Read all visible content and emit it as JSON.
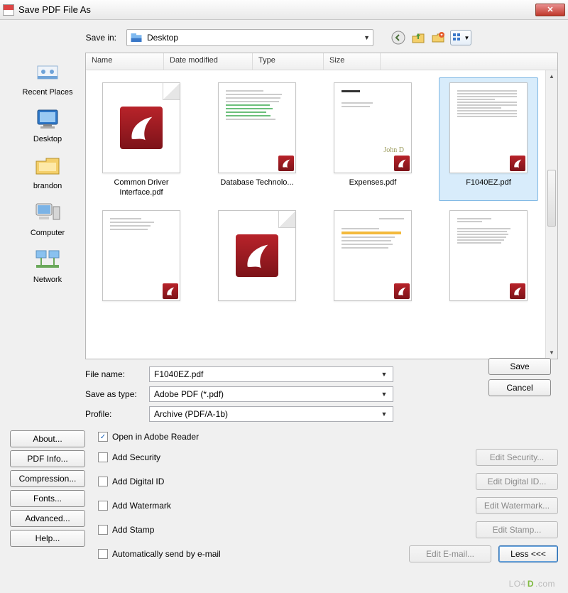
{
  "title": "Save PDF File As",
  "toolbar": {
    "savein_label": "Save in:",
    "savein_value": "Desktop"
  },
  "sidebar": {
    "items": [
      {
        "label": "Recent Places"
      },
      {
        "label": "Desktop"
      },
      {
        "label": "brandon"
      },
      {
        "label": "Computer"
      },
      {
        "label": "Network"
      }
    ]
  },
  "columns": {
    "c0": "Name",
    "c1": "Date modified",
    "c2": "Type",
    "c3": "Size"
  },
  "files": [
    {
      "name": "Common Driver Interface.pdf",
      "style": "bigicon"
    },
    {
      "name": "Database Technolo...",
      "style": "greentext"
    },
    {
      "name": "Expenses.pdf",
      "style": "memo"
    },
    {
      "name": "F1040EZ.pdf",
      "style": "form",
      "selected": true
    },
    {
      "name": "",
      "style": "plaintext"
    },
    {
      "name": "",
      "style": "bigicon"
    },
    {
      "name": "",
      "style": "orangebar"
    },
    {
      "name": "",
      "style": "plaintext2"
    }
  ],
  "form": {
    "filename_label": "File name:",
    "filename_value": "F1040EZ.pdf",
    "type_label": "Save as type:",
    "type_value": "Adobe PDF (*.pdf)",
    "profile_label": "Profile:",
    "profile_value": "Archive (PDF/A-1b)",
    "save_btn": "Save",
    "cancel_btn": "Cancel"
  },
  "leftbuttons": {
    "b0": "About...",
    "b1": "PDF Info...",
    "b2": "Compression...",
    "b3": "Fonts...",
    "b4": "Advanced...",
    "b5": "Help..."
  },
  "options": {
    "o0": {
      "label": "Open in Adobe Reader",
      "checked": true
    },
    "o1": {
      "label": "Add Security",
      "edit": "Edit Security..."
    },
    "o2": {
      "label": "Add Digital ID",
      "edit": "Edit Digital ID..."
    },
    "o3": {
      "label": "Add Watermark",
      "edit": "Edit Watermark..."
    },
    "o4": {
      "label": "Add Stamp",
      "edit": "Edit Stamp..."
    },
    "o5": {
      "label": "Automatically send by e-mail",
      "edit": "Edit E-mail..."
    }
  },
  "less_btn": "Less <<<",
  "watermark": "LO4D.com"
}
